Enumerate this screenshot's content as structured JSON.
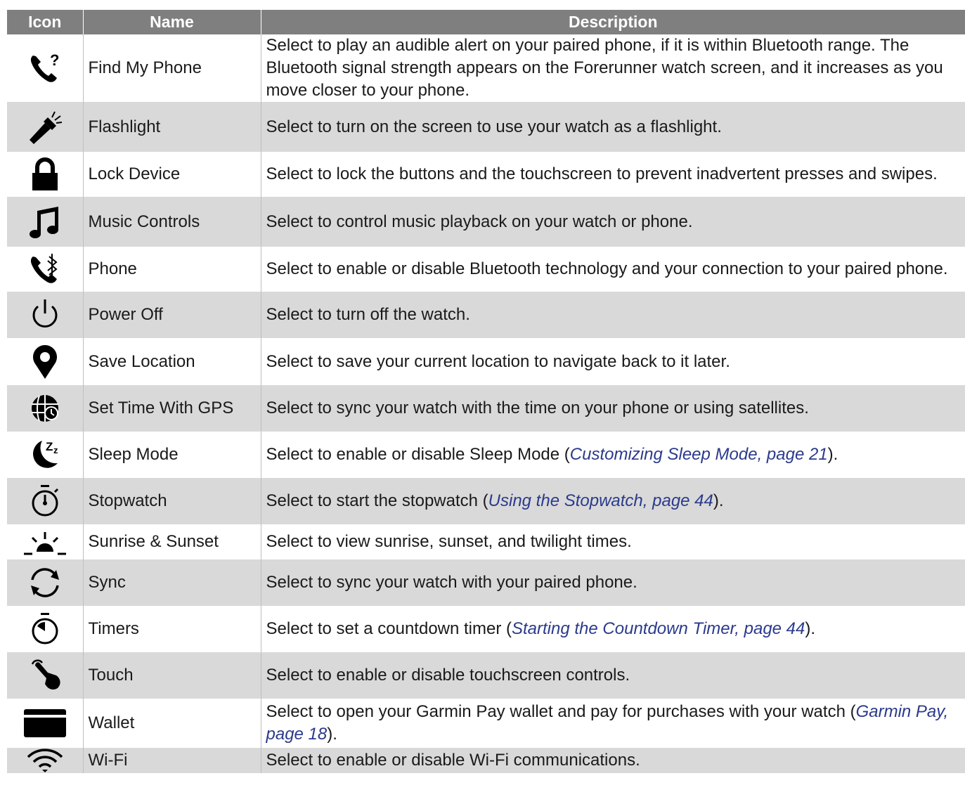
{
  "table": {
    "headers": {
      "icon": "Icon",
      "name": "Name",
      "description": "Description"
    },
    "rows": [
      {
        "icon": "phone-question-icon",
        "name": "Find My Phone",
        "desc": {
          "pre": "Select to play an audible alert on your paired phone, if it is within Bluetooth range. The Bluetooth signal strength appears on the Forerunner watch screen, and it increases as you move closer to your phone.",
          "link": "",
          "post": ""
        }
      },
      {
        "icon": "flashlight-icon",
        "name": "Flashlight",
        "desc": {
          "pre": "Select to turn on the screen to use your watch as a flashlight.",
          "link": "",
          "post": ""
        }
      },
      {
        "icon": "lock-icon",
        "name": "Lock Device",
        "desc": {
          "pre": "Select to lock the buttons and the touchscreen to prevent inadvertent presses and swipes.",
          "link": "",
          "post": ""
        }
      },
      {
        "icon": "music-note-icon",
        "name": "Music Controls",
        "desc": {
          "pre": "Select to control music playback on your watch or phone.",
          "link": "",
          "post": ""
        }
      },
      {
        "icon": "phone-bluetooth-icon",
        "name": "Phone",
        "desc": {
          "pre": "Select to enable or disable Bluetooth technology and your connection to your paired phone.",
          "link": "",
          "post": ""
        }
      },
      {
        "icon": "power-icon",
        "name": "Power Off",
        "desc": {
          "pre": "Select to turn off the watch.",
          "link": "",
          "post": ""
        }
      },
      {
        "icon": "location-pin-icon",
        "name": "Save Location",
        "desc": {
          "pre": "Select to save your current location to navigate back to it later.",
          "link": "",
          "post": ""
        }
      },
      {
        "icon": "globe-clock-icon",
        "name": "Set Time With GPS",
        "desc": {
          "pre": "Select to sync your watch with the time on your phone or using satellites.",
          "link": "",
          "post": ""
        }
      },
      {
        "icon": "moon-sleep-icon",
        "name": "Sleep Mode",
        "desc": {
          "pre": "Select to enable or disable Sleep Mode (",
          "link": "Customizing Sleep Mode, page 21",
          "post": ")."
        }
      },
      {
        "icon": "stopwatch-icon",
        "name": "Stopwatch",
        "desc": {
          "pre": "Select to start the stopwatch (",
          "link": "Using the Stopwatch, page 44",
          "post": ")."
        }
      },
      {
        "icon": "sunrise-icon",
        "name": "Sunrise & Sunset",
        "desc": {
          "pre": "Select to view sunrise, sunset, and twilight times.",
          "link": "",
          "post": ""
        }
      },
      {
        "icon": "sync-icon",
        "name": "Sync",
        "desc": {
          "pre": "Select to sync your watch with your paired phone.",
          "link": "",
          "post": ""
        }
      },
      {
        "icon": "timer-icon",
        "name": "Timers",
        "desc": {
          "pre": "Select to set a countdown timer (",
          "link": "Starting the Countdown Timer, page 44",
          "post": ")."
        }
      },
      {
        "icon": "touch-hand-icon",
        "name": "Touch",
        "desc": {
          "pre": "Select to enable or disable touchscreen controls.",
          "link": "",
          "post": ""
        }
      },
      {
        "icon": "wallet-card-icon",
        "name": "Wallet",
        "desc": {
          "pre": "Select to open your Garmin Pay wallet and pay for purchases with your watch (",
          "link": "Garmin Pay, page 18",
          "post": ")."
        }
      },
      {
        "icon": "wifi-icon",
        "name": "Wi-Fi",
        "desc": {
          "pre": "Select to enable or disable Wi-Fi communications.",
          "link": "",
          "post": ""
        }
      }
    ]
  },
  "colors": {
    "header_bg": "#7f7f7f",
    "stripe_bg": "#d9d9d9",
    "link": "#2b3a8c",
    "text": "#1a1a1a"
  }
}
